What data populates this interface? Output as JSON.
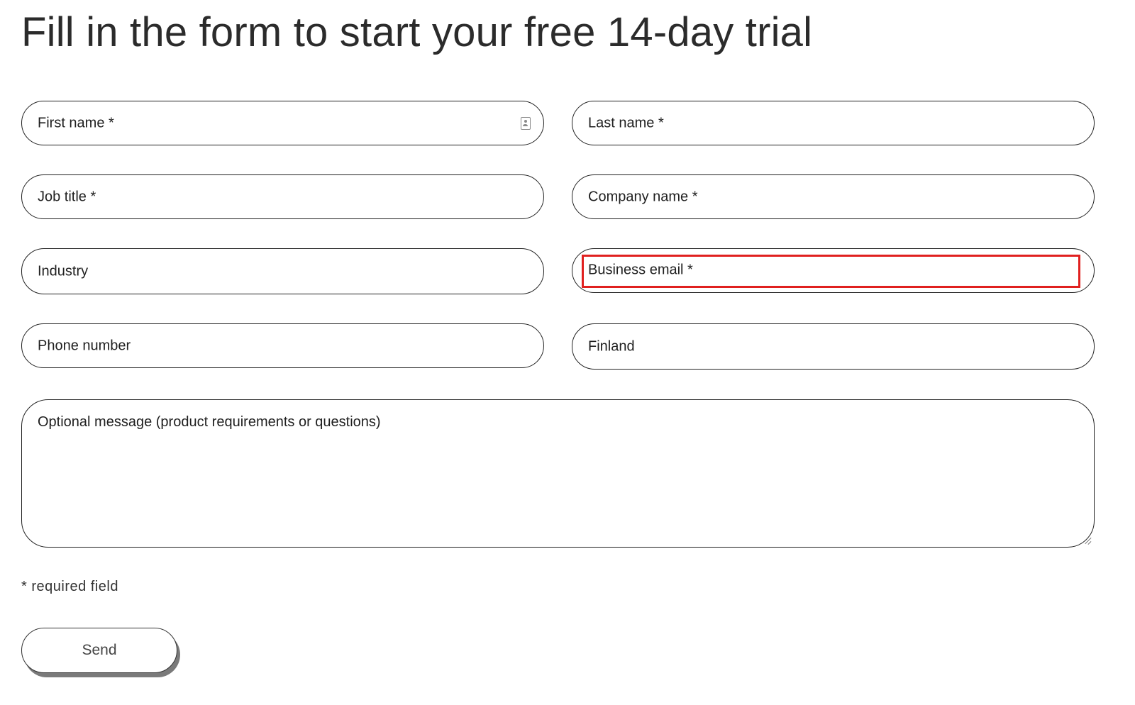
{
  "page": {
    "title": "Fill in the form to start your free 14-day trial"
  },
  "form": {
    "first_name": "First name *",
    "last_name": "Last name *",
    "job_title": "Job title *",
    "company_name": "Company name *",
    "industry": "Industry",
    "business_email": "Business email *",
    "phone_number": "Phone number",
    "country": "Finland",
    "message": "Optional message (product requirements or questions)",
    "required_note": "* required field",
    "send_label": "Send"
  },
  "icons": {
    "autofill": "contact-card-icon",
    "resize": "resize-handle-icon"
  },
  "colors": {
    "border": "#222222",
    "highlight": "#e0201f",
    "text": "#1f1f1f",
    "button_shadow": "#7a7a7a"
  }
}
